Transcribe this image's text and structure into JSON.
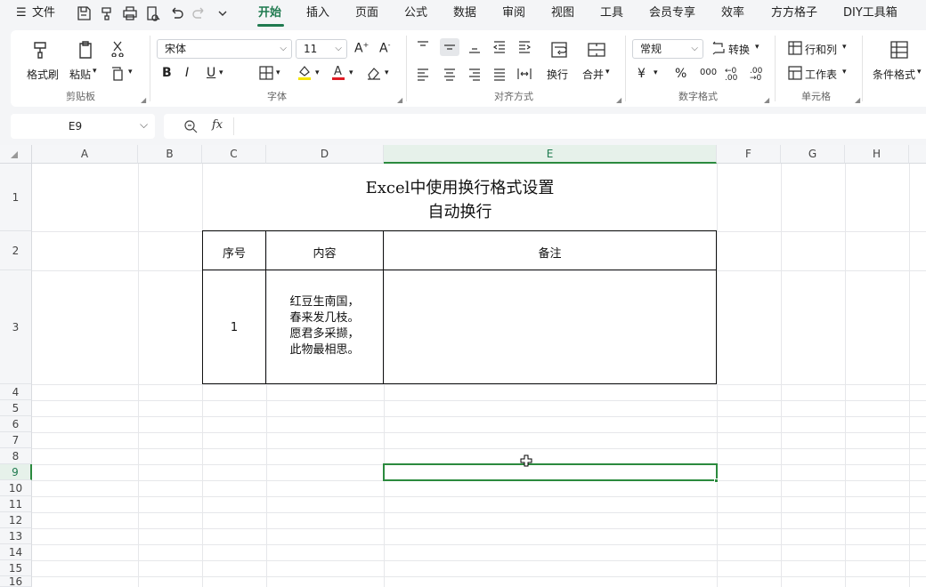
{
  "menubar": {
    "app_menu": "文件",
    "tabs": [
      "开始",
      "插入",
      "页面",
      "公式",
      "数据",
      "审阅",
      "视图",
      "工具",
      "会员专享",
      "效率",
      "方方格子",
      "DIY工具箱"
    ],
    "active_tab": "开始"
  },
  "ribbon": {
    "clipboard": {
      "format_painter": "格式刷",
      "paste": "粘贴",
      "group_label": "剪贴板"
    },
    "font": {
      "font_name": "宋体",
      "font_size": "11",
      "group_label": "字体"
    },
    "alignment": {
      "wrap": "换行",
      "merge": "合并",
      "group_label": "对齐方式"
    },
    "number": {
      "format": "常规",
      "convert": "转换",
      "group_label": "数字格式"
    },
    "cells": {
      "row_col": "行和列",
      "worksheet": "工作表",
      "group_label": "单元格"
    },
    "cond_format": "条件格式"
  },
  "formula_bar": {
    "name_box": "E9",
    "fx": "fx",
    "content": ""
  },
  "sheet": {
    "columns": [
      "A",
      "B",
      "C",
      "D",
      "E",
      "F",
      "G",
      "H"
    ],
    "selected_column": "E",
    "rows": [
      "1",
      "2",
      "3",
      "4",
      "5",
      "6",
      "7",
      "8",
      "9",
      "10",
      "11",
      "12",
      "13",
      "14",
      "15",
      "16"
    ],
    "selected_row": "9",
    "title_line1": "Excel中使用换行格式设置",
    "title_line2": "自动换行",
    "table": {
      "headers": [
        "序号",
        "内容",
        "备注"
      ],
      "row": {
        "no": "1",
        "content_lines": [
          "红豆生南国，",
          "春来发几枝。",
          "愿君多采撷，",
          "此物最相思。"
        ],
        "note": ""
      }
    }
  },
  "colors": {
    "accent": "#1f7a4f",
    "selection": "#2b8a3e"
  }
}
